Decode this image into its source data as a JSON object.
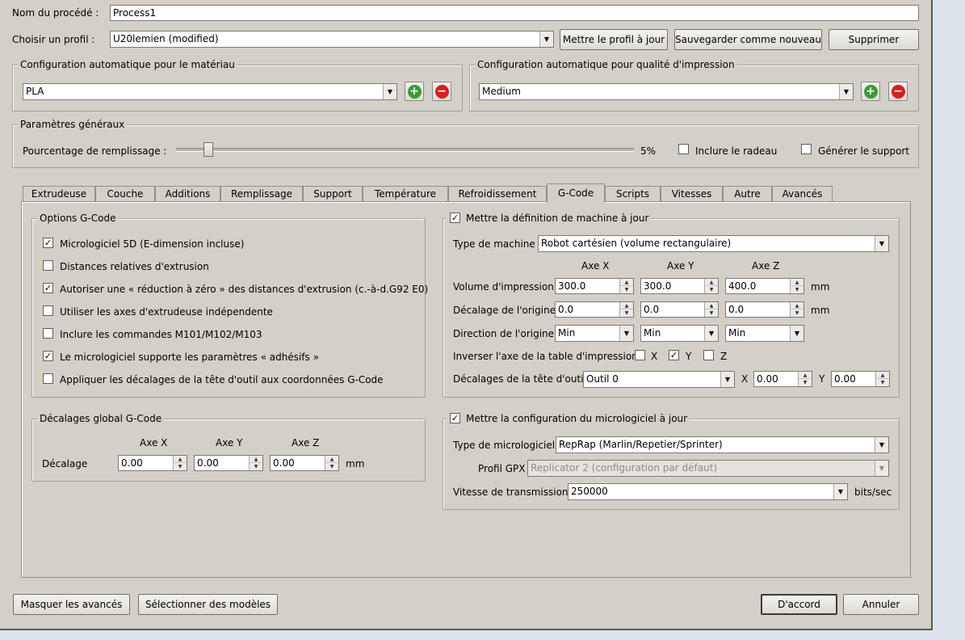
{
  "colors": {
    "dialog_bg": "#d4d0c8",
    "add": "#3a9a3a",
    "remove": "#d42020"
  },
  "header": {
    "process_name_label": "Nom du procédé :",
    "process_name_value": "Process1",
    "profile_label": "Choisir un profil :",
    "profile_value": "U20lemien (modified)",
    "update_profile_button": "Mettre le profil à jour",
    "save_new_button": "Sauvegarder comme nouveau",
    "delete_button": "Supprimer"
  },
  "material": {
    "group_label": "Configuration automatique pour le matériau",
    "value": "PLA",
    "add_icon": "plus-icon",
    "remove_icon": "minus-icon"
  },
  "quality": {
    "group_label": "Configuration automatique pour qualité d'impression",
    "value": "Medium"
  },
  "general": {
    "group_label": "Paramètres généraux",
    "infill_label": "Pourcentage de remplissage :",
    "infill_percent": 5,
    "infill_value_text": "5%",
    "raft_label": "Inclure le radeau",
    "raft_checked": false,
    "support_label": "Générer le support",
    "support_checked": false
  },
  "tabs": [
    {
      "label": "Extrudeuse"
    },
    {
      "label": "Couche"
    },
    {
      "label": "Additions"
    },
    {
      "label": "Remplissage"
    },
    {
      "label": "Support"
    },
    {
      "label": "Température"
    },
    {
      "label": "Refroidissement"
    },
    {
      "label": "G-Code"
    },
    {
      "label": "Scripts"
    },
    {
      "label": "Vitesses"
    },
    {
      "label": "Autre"
    },
    {
      "label": "Avancés"
    }
  ],
  "active_tab": "G-Code",
  "gcode_options": {
    "group_label": "Options G-Code",
    "items": [
      {
        "label": "Micrologiciel 5D (E-dimension incluse)",
        "checked": true
      },
      {
        "label": "Distances relatives d'extrusion",
        "checked": false
      },
      {
        "label": "Autoriser une « réduction à zéro » des distances d'extrusion (c.-à-d.G92 E0)",
        "checked": true
      },
      {
        "label": "Utiliser les axes d'extrudeuse indépendente",
        "checked": false
      },
      {
        "label": "Inclure les commandes M101/M102/M103",
        "checked": false
      },
      {
        "label": "Le micrologiciel supporte les paramètres « adhésifs »",
        "checked": true
      },
      {
        "label": "Appliquer les décalages de la tête d'outil aux coordonnées G-Code",
        "checked": false
      }
    ]
  },
  "global_offsets": {
    "group_label": "Décalages global G-Code",
    "axis_x": "Axe X",
    "axis_y": "Axe Y",
    "axis_z": "Axe Z",
    "row_label": "Décalage",
    "x": "0.00",
    "y": "0.00",
    "z": "0.00",
    "unit": "mm"
  },
  "machine": {
    "group_label": "Mettre la définition de machine à jour",
    "checked": true,
    "type_label": "Type de machine",
    "type_value": "Robot cartésien (volume rectangulaire)",
    "axis_x": "Axe X",
    "axis_y": "Axe Y",
    "axis_z": "Axe Z",
    "volume_label": "Volume d'impression",
    "volume": [
      "300.0",
      "300.0",
      "400.0"
    ],
    "origin_offset_label": "Décalage de l'origine",
    "origin_offset": [
      "0.0",
      "0.0",
      "0.0"
    ],
    "unit": "mm",
    "origin_dir_label": "Direction de l'origine",
    "origin_dir": [
      "Min",
      "Min",
      "Min"
    ],
    "invert_label": "Inverser l'axe de la table d'impression",
    "invert": [
      {
        "label": "X",
        "checked": false
      },
      {
        "label": "Y",
        "checked": true
      },
      {
        "label": "Z",
        "checked": false
      }
    ],
    "toolhead_label": "Décalages de la tête d'outil",
    "tool_value": "Outil 0",
    "tool_x_label": "X",
    "tool_x": "0.00",
    "tool_y_label": "Y",
    "tool_y": "0.00"
  },
  "firmware": {
    "group_label": "Mettre la configuration du micrologiciel à jour",
    "checked": true,
    "type_label": "Type de micrologiciel",
    "type_value": "RepRap (Marlin/Repetier/Sprinter)",
    "gpx_label": "Profil GPX",
    "gpx_value": "Replicator 2 (configuration par défaut)",
    "baud_label": "Vitesse de transmission",
    "baud_value": "250000",
    "baud_unit": "bits/sec"
  },
  "footer": {
    "hide_advanced_button": "Masquer les avancés",
    "select_models_button": "Sélectionner des modèles",
    "ok_button": "D'accord",
    "cancel_button": "Annuler"
  }
}
